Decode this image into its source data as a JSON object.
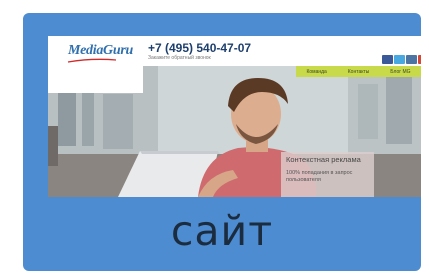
{
  "caption": "сайт",
  "site": {
    "logo_text": "MediaGuru",
    "phone": "+7 (495) 540-47-07",
    "callback_label": "Закажите обратный звонок",
    "social_icons": [
      {
        "name": "facebook-icon",
        "color": "#3b5998"
      },
      {
        "name": "twitter-icon",
        "color": "#4aa8e0"
      },
      {
        "name": "vk-icon",
        "color": "#4c75a3"
      },
      {
        "name": "google-plus-icon",
        "color": "#d34836"
      }
    ],
    "nav": [
      "Команда",
      "Контакты",
      "Блог МG"
    ],
    "overlay": {
      "title": "Контекстная реклама",
      "text": "100% попадания в запрос пользователя"
    }
  },
  "colors": {
    "card_blue": "#4d8cd1",
    "caption_text": "#1c2c3f",
    "nav_green": "#c8d94a",
    "phone_blue": "#1e3f6d"
  }
}
